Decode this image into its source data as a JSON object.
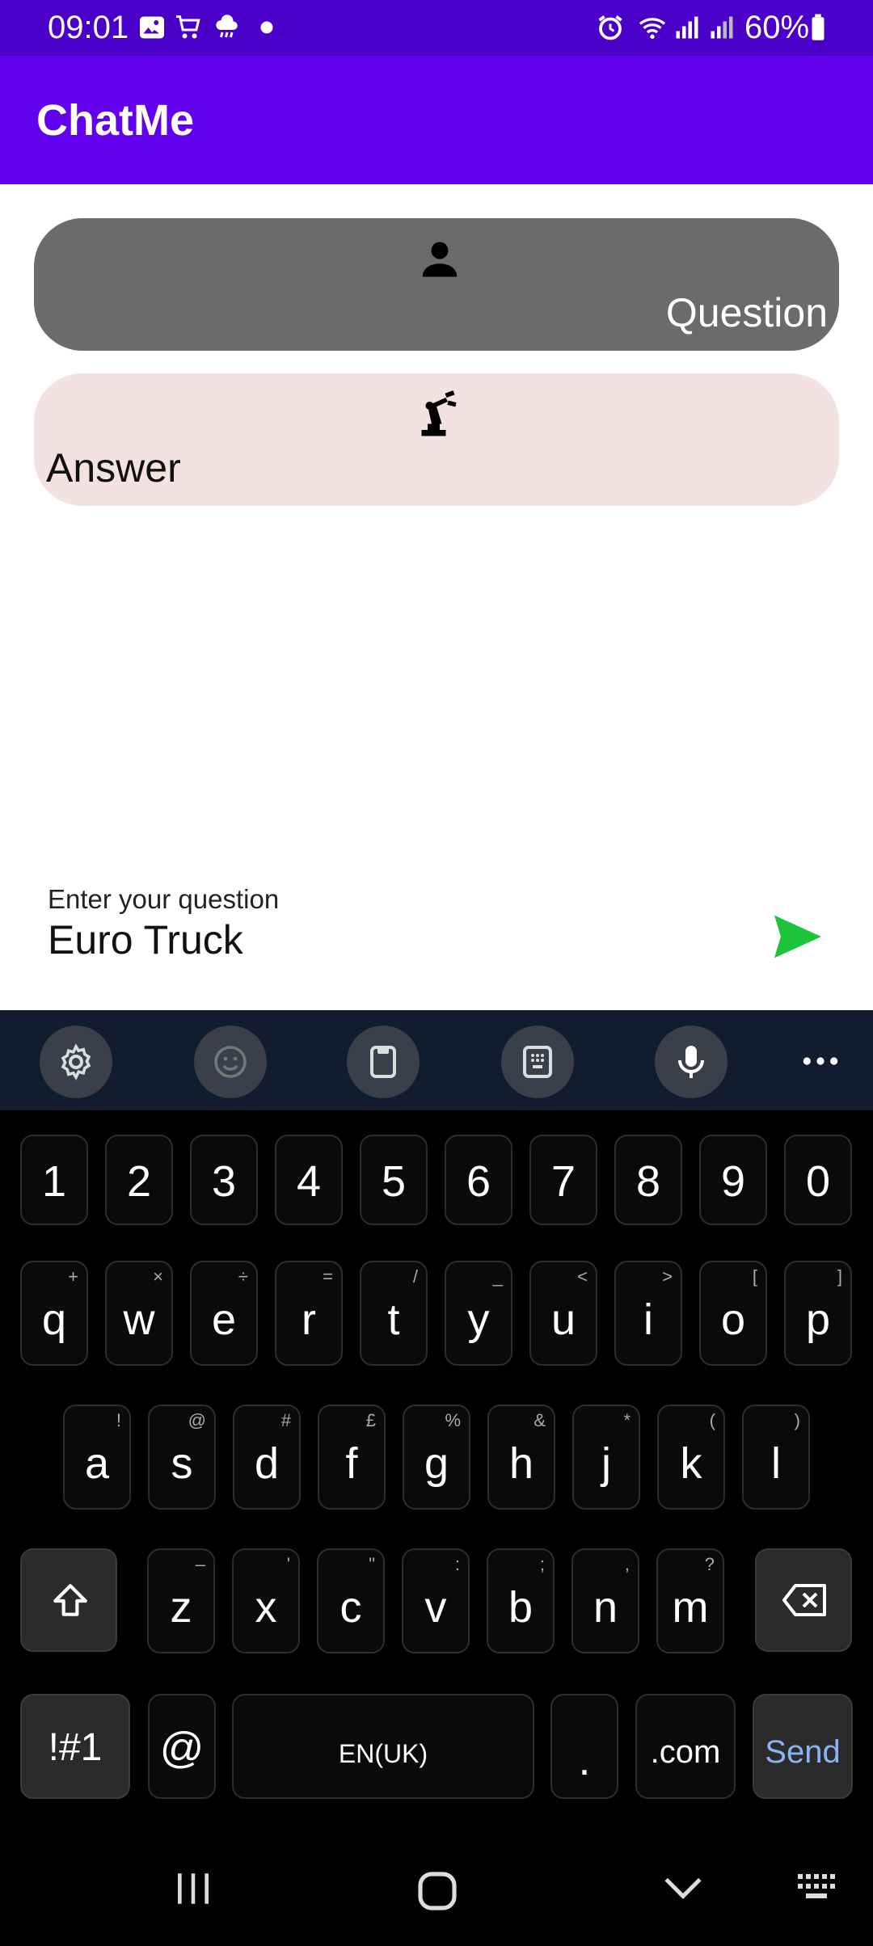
{
  "status_bar": {
    "time": "09:01",
    "battery": "60%",
    "icons": [
      "gallery-icon",
      "shopping-cart-icon",
      "weather-icon",
      "dot-icon",
      "alarm-icon",
      "wifi-icon",
      "signal-icon",
      "signal-icon",
      "battery-icon"
    ]
  },
  "app": {
    "title": "ChatMe",
    "accent": "#6200ee"
  },
  "messages": [
    {
      "role": "question",
      "icon": "person-icon",
      "text": "Question"
    },
    {
      "role": "answer",
      "icon": "robot-arm-icon",
      "text": "Answer"
    }
  ],
  "input": {
    "label": "Enter your question",
    "value": "Euro Truck",
    "send_icon": "send-icon",
    "send_color": "#1bc43a"
  },
  "keyboard": {
    "toolbar": [
      "settings-icon",
      "emoji-icon",
      "clipboard-icon",
      "keypad-icon",
      "mic-icon",
      "more-icon"
    ],
    "row_numbers": [
      "1",
      "2",
      "3",
      "4",
      "5",
      "6",
      "7",
      "8",
      "9",
      "0"
    ],
    "row_q": [
      {
        "main": "q",
        "sub": "+"
      },
      {
        "main": "w",
        "sub": "×"
      },
      {
        "main": "e",
        "sub": "÷"
      },
      {
        "main": "r",
        "sub": "="
      },
      {
        "main": "t",
        "sub": "/"
      },
      {
        "main": "y",
        "sub": "_"
      },
      {
        "main": "u",
        "sub": "<"
      },
      {
        "main": "i",
        "sub": ">"
      },
      {
        "main": "o",
        "sub": "["
      },
      {
        "main": "p",
        "sub": "]"
      }
    ],
    "row_a": [
      {
        "main": "a",
        "sub": "!"
      },
      {
        "main": "s",
        "sub": "@"
      },
      {
        "main": "d",
        "sub": "#"
      },
      {
        "main": "f",
        "sub": "£"
      },
      {
        "main": "g",
        "sub": "%"
      },
      {
        "main": "h",
        "sub": "&"
      },
      {
        "main": "j",
        "sub": "*"
      },
      {
        "main": "k",
        "sub": "("
      },
      {
        "main": "l",
        "sub": ")"
      }
    ],
    "row_z": [
      {
        "main": "z",
        "sub": "–"
      },
      {
        "main": "x",
        "sub": "'"
      },
      {
        "main": "c",
        "sub": "\""
      },
      {
        "main": "v",
        "sub": ":"
      },
      {
        "main": "b",
        "sub": ";"
      },
      {
        "main": "n",
        "sub": ","
      },
      {
        "main": "m",
        "sub": "?"
      }
    ],
    "symbols_label": "!#1",
    "at_label": "@",
    "space_label": "EN(UK)",
    "period_label": ".",
    "dotcom_label": ".com",
    "send_label": "Send",
    "send_color": "#8ab4f8"
  },
  "nav_bar": [
    "recents-icon",
    "home-icon",
    "back-icon",
    "keyboard-switch-icon"
  ]
}
